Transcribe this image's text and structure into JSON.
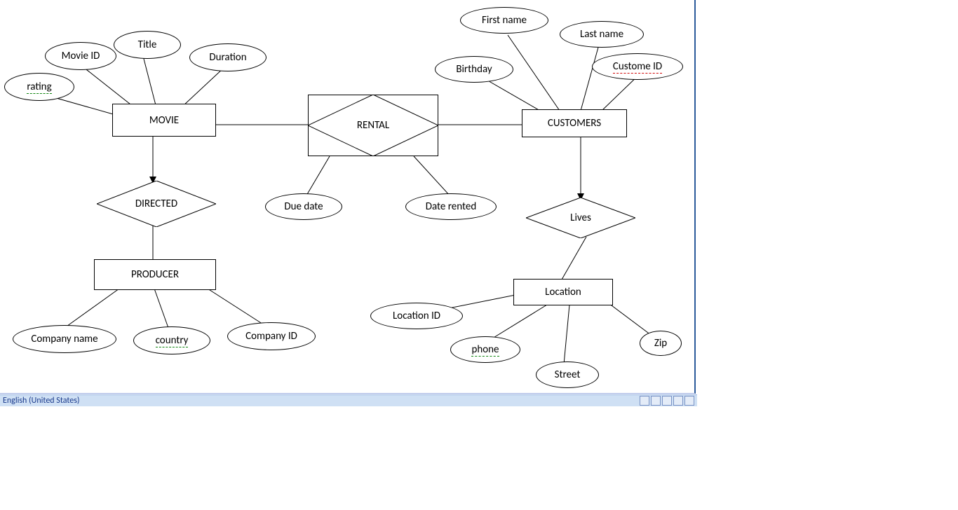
{
  "status": {
    "language": "English (United States)"
  },
  "entities": {
    "movie": {
      "label": "MOVIE"
    },
    "customers": {
      "label": "CUSTOMERS"
    },
    "producer": {
      "label": "PRODUCER"
    },
    "location": {
      "label": "Location"
    }
  },
  "relationships": {
    "rental": {
      "label": "RENTAL"
    },
    "directed": {
      "label": "DIRECTED"
    },
    "lives": {
      "label": "Lives"
    }
  },
  "attributes": {
    "movie_id": {
      "label": "Movie ID"
    },
    "title": {
      "label": "Title"
    },
    "duration": {
      "label": "Duration"
    },
    "rating": {
      "label": "rating"
    },
    "due_date": {
      "label": "Due date"
    },
    "date_rented": {
      "label": "Date rented"
    },
    "company_name": {
      "label": "Company name"
    },
    "country": {
      "label": "country"
    },
    "company_id": {
      "label": "Company ID"
    },
    "first_name": {
      "label": "First name"
    },
    "last_name": {
      "label": "Last name"
    },
    "birthday": {
      "label": "Birthday"
    },
    "customer_id": {
      "label": "Custome ID"
    },
    "location_id": {
      "label": "Location ID"
    },
    "phone": {
      "label": "phone"
    },
    "street": {
      "label": "Street"
    },
    "zip": {
      "label": "Zip"
    }
  }
}
